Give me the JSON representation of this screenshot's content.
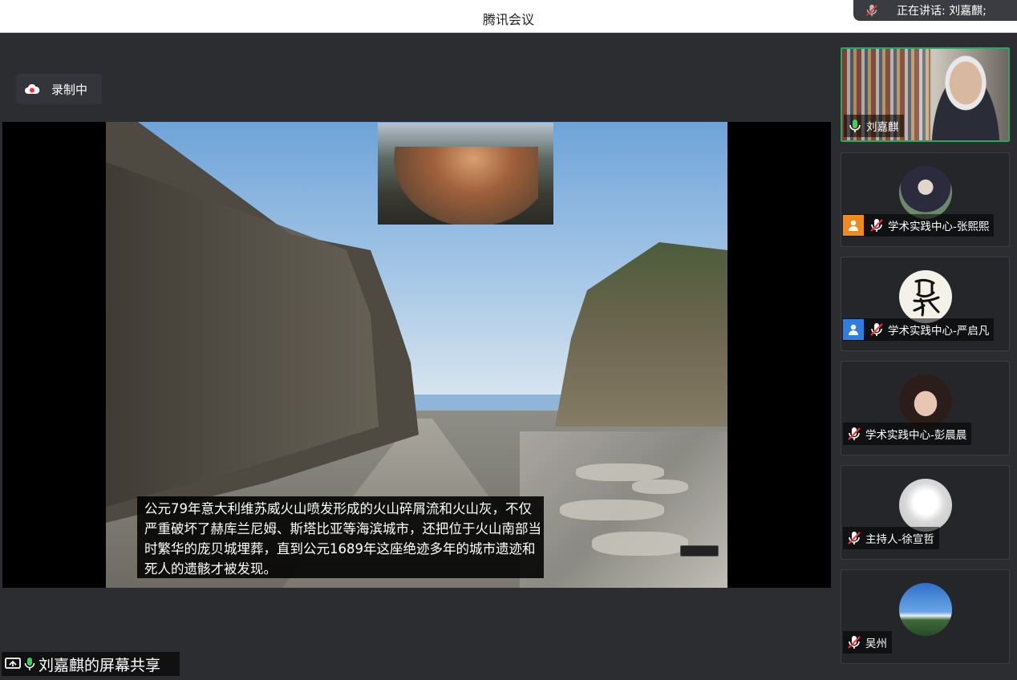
{
  "window": {
    "title": "腾讯会议"
  },
  "speaking": {
    "text": "正在讲话: 刘嘉麒;"
  },
  "recording": {
    "label": "录制中"
  },
  "slide": {
    "caption": "公元79年意大利维苏威火山喷发形成的火山碎屑流和火山灰，不仅严重破坏了赫库兰尼姆、斯塔比亚等海滨城市，还把位于火山南部当时繁华的庞贝城埋葬，直到公元1689年这座绝迹多年的城市遗迹和死人的遗骸才被发现。"
  },
  "share": {
    "label": "刘嘉麒的屏幕共享"
  },
  "participants": [
    {
      "name": "刘嘉麒",
      "mic": "on",
      "role": "none"
    },
    {
      "name": "学术实践中心-张熙熙",
      "mic": "muted",
      "role": "orange-person"
    },
    {
      "name": "学术实践中心-严启凡",
      "mic": "muted",
      "role": "blue-person"
    },
    {
      "name": "学术实践中心-彭晨晨",
      "mic": "muted",
      "role": "none"
    },
    {
      "name": "主持人-徐宣哲",
      "mic": "muted",
      "role": "none"
    },
    {
      "name": "吴州",
      "mic": "muted",
      "role": "none"
    }
  ],
  "colors": {
    "active_border": "#2aa564",
    "mic_on": "#3fd05a",
    "mic_muted": "#ffffff",
    "record": "#e8383a",
    "role_orange": "#f0891e",
    "role_blue": "#2f7de1"
  }
}
